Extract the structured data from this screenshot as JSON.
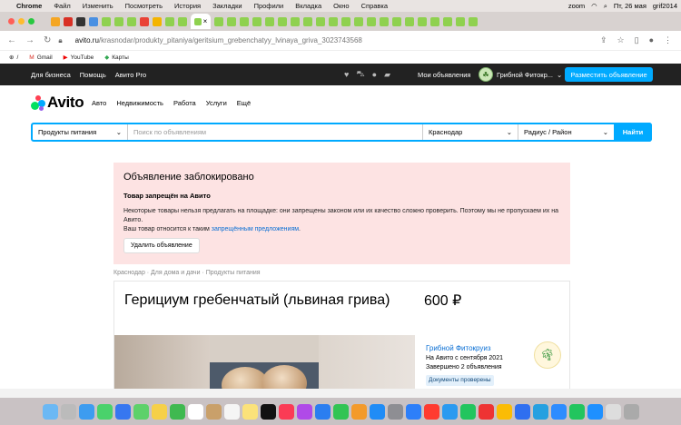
{
  "menubar": {
    "items": [
      "Chrome",
      "Файл",
      "Изменить",
      "Посмотреть",
      "История",
      "Закладки",
      "Профили",
      "Вкладка",
      "Окно",
      "Справка"
    ],
    "right": [
      "zoom",
      "Пт, 26 мая",
      "grif2014"
    ]
  },
  "tab": {
    "close": "×"
  },
  "address": {
    "host": "avito.ru",
    "path": "/krasnodar/produkty_pitaniya/geritsium_grebenchatyy_lvinaya_griva_3023743568"
  },
  "bookmarks": [
    {
      "label": "/",
      "icon": "globe-icon"
    },
    {
      "label": "Gmail",
      "icon": "gmail-icon"
    },
    {
      "label": "YouTube",
      "icon": "youtube-icon"
    },
    {
      "label": "Карты",
      "icon": "maps-icon"
    }
  ],
  "avito_header": {
    "links": [
      "Для бизнеса",
      "Помощь",
      "Авито Pro"
    ],
    "my_ads": "Мои объявления",
    "user_name": "Грибной Фитокр...",
    "post_button": "Разместить объявление"
  },
  "logo": {
    "word": "Avito"
  },
  "categories": [
    "Авто",
    "Недвижимость",
    "Работа",
    "Услуги",
    "Ещё"
  ],
  "search": {
    "category": "Продукты питания",
    "placeholder": "Поиск по объявлениям",
    "city": "Краснодар",
    "radius": "Радиус / Район",
    "button": "Найти"
  },
  "blocked": {
    "title": "Объявление заблокировано",
    "subtitle": "Товар запрещён на Авито",
    "text": "Некоторые товары нельзя предлагать на площадке: они запрещены законом или их качество сложно проверить. Поэтому мы не пропускаем их на Авито.",
    "text2_prefix": "Ваш товар относится к таким ",
    "text2_link": "запрещённым предложениям",
    "text2_suffix": ".",
    "delete_button": "Удалить объявление"
  },
  "breadcrumbs": "Краснодар · Для дома и дачи · Продукты питания",
  "item": {
    "title": "Герициум гребенчатый (львиная грива)",
    "price": "600 ₽"
  },
  "seller": {
    "name": "Грибной Фитокруиз",
    "since": "На Авито с сентября 2021",
    "completed": "Завершено 2 объявления",
    "docs_badge": "Документы проверены"
  },
  "colors": {
    "accent": "#00aaff",
    "blocked_bg": "#fde3e3",
    "link": "#0a6fd4"
  }
}
